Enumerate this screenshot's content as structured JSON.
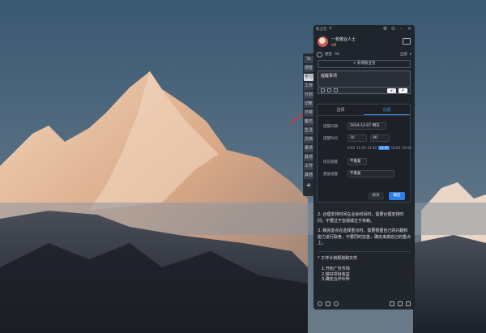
{
  "window": {
    "title": "敬业签",
    "badge": "8"
  },
  "user": {
    "name": "一枚敬业人士",
    "vip_label": "VIP"
  },
  "filter": {
    "category_label": "便签",
    "category_count": "30",
    "sort_label": "全部"
  },
  "new_button_label": "+ 新增敬业签",
  "editor": {
    "text": "提醒事项",
    "save_label": "✔"
  },
  "tabstrip": {
    "items": [
      "To",
      "便签",
      "学习",
      "工作",
      "计划",
      "记账",
      "日常",
      "备忘",
      "生活",
      "文档",
      "事项",
      "其他",
      "工作",
      "其他"
    ],
    "add_label": "+"
  },
  "reminder_popup": {
    "tabs": [
      "选择",
      "设置"
    ],
    "date_label": "提醒日期",
    "date_value": "2024-12-07 明天",
    "time_label": "提醒时间",
    "hour_value": "16",
    "minute_value": "00",
    "quick_times": [
      "9:00",
      "11:00",
      "14:00",
      "16:00",
      "18:00",
      "20:00"
    ],
    "advance_label": "提前提醒",
    "advance_value": "不重复",
    "repeat_label": "重复提醒",
    "repeat_value": "不重复",
    "cancel_label": "取消",
    "confirm_label": "确定"
  },
  "note_content": {
    "paragraph_2": "2. 合理安排时间在业余时间时，需要合理安排时间，不要过于忽视或过于依赖。",
    "paragraph_3": "3. 稿完善点在选择重点时，需要根据自己的兴趣和能力进行取舍，不要同时完善，确定来做自己的重点上。",
    "section_title": "* 工作计划规划和文件",
    "items": [
      "1.开拓广告市场",
      "2.做好项目收益",
      "3.确定合作伙伴"
    ]
  }
}
